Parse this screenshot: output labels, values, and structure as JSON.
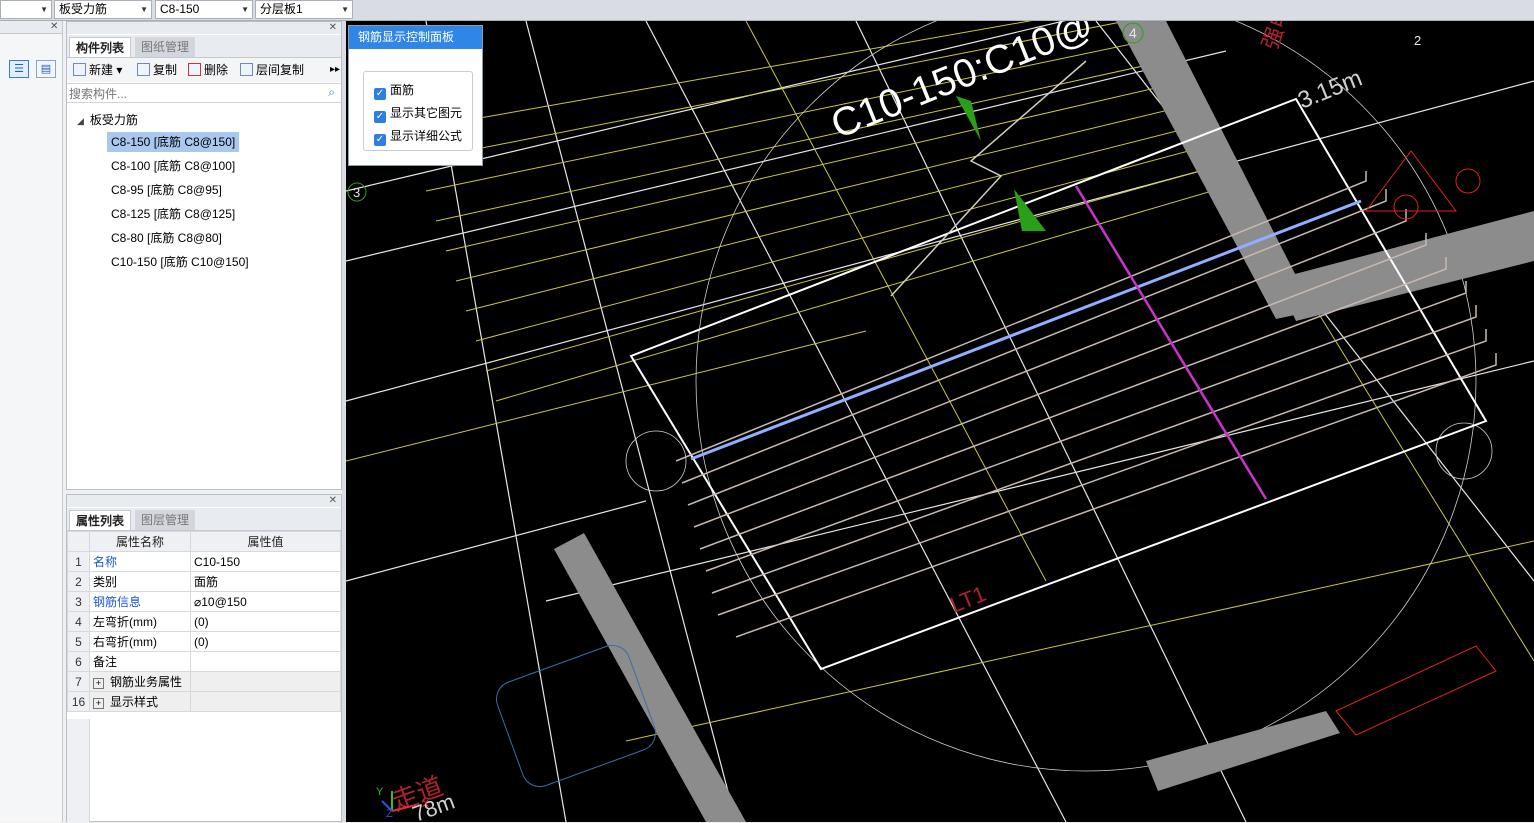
{
  "toolbar": {
    "combo_category": "板受力筋",
    "combo_component": "C8-150",
    "combo_layer": "分层板1"
  },
  "component_panel": {
    "tabs": [
      "构件列表",
      "图纸管理"
    ],
    "buttons": {
      "new": "新建",
      "copy": "复制",
      "delete": "删除",
      "floor_copy": "层间复制"
    },
    "search_placeholder": "搜索构件...",
    "tree_root": "板受力筋",
    "items": [
      "C8-150 [底筋 C8@150]",
      "C8-100 [底筋 C8@100]",
      "C8-95 [底筋 C8@95]",
      "C8-125 [底筋 C8@125]",
      "C8-80 [底筋 C8@80]",
      "C10-150 [底筋 C10@150]"
    ]
  },
  "property_panel": {
    "tabs": [
      "属性列表",
      "图层管理"
    ],
    "headers": [
      "属性名称",
      "属性值"
    ],
    "rows": [
      {
        "num": "1",
        "name": "名称",
        "value": "C10-150"
      },
      {
        "num": "2",
        "name": "类别",
        "value": "面筋"
      },
      {
        "num": "3",
        "name": "钢筋信息",
        "value": "⌀10@150"
      },
      {
        "num": "4",
        "name": "左弯折(mm)",
        "value": "(0)"
      },
      {
        "num": "5",
        "name": "右弯折(mm)",
        "value": "(0)"
      },
      {
        "num": "6",
        "name": "备注",
        "value": ""
      },
      {
        "num": "7",
        "name": "钢筋业务属性",
        "value": ""
      },
      {
        "num": "16",
        "name": "显示样式",
        "value": ""
      }
    ]
  },
  "rebar_panel": {
    "title": "钢筋显示控制面板",
    "options": [
      "面筋",
      "显示其它图元",
      "显示详细公式"
    ]
  },
  "viewport": {
    "label_rebar": "C10-150:C10@",
    "label_dim": "3.15m",
    "label_axis3": "3",
    "label_axis4": "4",
    "label_axis2": "2",
    "label_corridor": "走道",
    "label_lt": "LT1",
    "label_bottom_dim": "78m",
    "label_qiangdian": "强电",
    "axis_x": "X",
    "axis_y": "Y",
    "axis_z": "Z"
  },
  "colors": {
    "accent_blue": "#2f86e6",
    "selected_row": "#a9c8ef",
    "cad_background": "#000000"
  }
}
